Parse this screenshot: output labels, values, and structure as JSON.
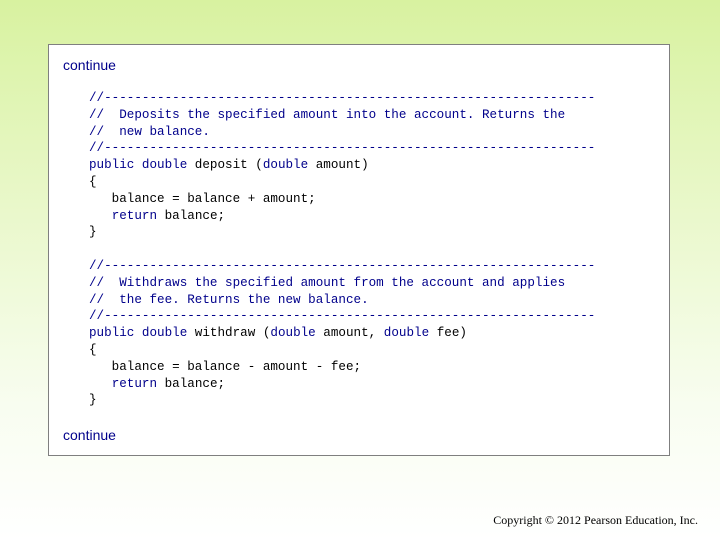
{
  "slide": {
    "continue_top": "continue",
    "continue_bottom": "continue",
    "footer": "Copyright © 2012 Pearson Education, Inc."
  },
  "code": {
    "lines": [
      {
        "segments": [
          {
            "t": "//-----------------------------------------------------------------",
            "c": "comment"
          }
        ]
      },
      {
        "segments": [
          {
            "t": "//  Deposits the specified amount into the account. Returns the",
            "c": "comment"
          }
        ]
      },
      {
        "segments": [
          {
            "t": "//  new balance.",
            "c": "comment"
          }
        ]
      },
      {
        "segments": [
          {
            "t": "//-----------------------------------------------------------------",
            "c": "comment"
          }
        ]
      },
      {
        "segments": [
          {
            "t": "public double",
            "c": "kw"
          },
          {
            "t": " deposit (",
            "c": ""
          },
          {
            "t": "double",
            "c": "kw"
          },
          {
            "t": " amount)",
            "c": ""
          }
        ]
      },
      {
        "segments": [
          {
            "t": "{",
            "c": ""
          }
        ]
      },
      {
        "segments": [
          {
            "t": "   balance = balance + amount;",
            "c": ""
          }
        ]
      },
      {
        "segments": [
          {
            "t": "   ",
            "c": ""
          },
          {
            "t": "return",
            "c": "kw"
          },
          {
            "t": " balance;",
            "c": ""
          }
        ]
      },
      {
        "segments": [
          {
            "t": "}",
            "c": ""
          }
        ]
      },
      {
        "segments": [
          {
            "t": "",
            "c": ""
          }
        ]
      },
      {
        "segments": [
          {
            "t": "//-----------------------------------------------------------------",
            "c": "comment"
          }
        ]
      },
      {
        "segments": [
          {
            "t": "//  Withdraws the specified amount from the account and applies",
            "c": "comment"
          }
        ]
      },
      {
        "segments": [
          {
            "t": "//  the fee. Returns the new balance.",
            "c": "comment"
          }
        ]
      },
      {
        "segments": [
          {
            "t": "//-----------------------------------------------------------------",
            "c": "comment"
          }
        ]
      },
      {
        "segments": [
          {
            "t": "public double",
            "c": "kw"
          },
          {
            "t": " withdraw (",
            "c": ""
          },
          {
            "t": "double",
            "c": "kw"
          },
          {
            "t": " amount, ",
            "c": ""
          },
          {
            "t": "double",
            "c": "kw"
          },
          {
            "t": " fee)",
            "c": ""
          }
        ]
      },
      {
        "segments": [
          {
            "t": "{",
            "c": ""
          }
        ]
      },
      {
        "segments": [
          {
            "t": "   balance = balance - amount - fee;",
            "c": ""
          }
        ]
      },
      {
        "segments": [
          {
            "t": "   ",
            "c": ""
          },
          {
            "t": "return",
            "c": "kw"
          },
          {
            "t": " balance;",
            "c": ""
          }
        ]
      },
      {
        "segments": [
          {
            "t": "}",
            "c": ""
          }
        ]
      }
    ]
  }
}
